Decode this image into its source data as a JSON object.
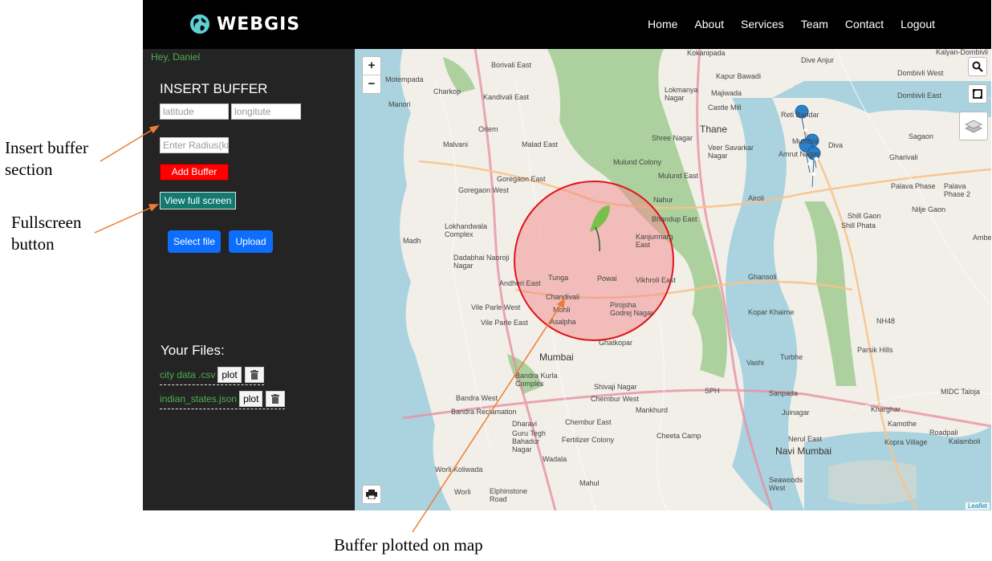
{
  "annotations": {
    "insert_buffer": [
      "Insert buffer",
      "section"
    ],
    "fullscreen": [
      "Fullscreen",
      "button"
    ],
    "buffer_map": "Buffer plotted on map"
  },
  "navbar": {
    "brand": "WEBGIS",
    "links": [
      "Home",
      "About",
      "Services",
      "Team",
      "Contact",
      "Logout"
    ]
  },
  "sidebar": {
    "greeting": "Hey, Daniel",
    "insert_title": "INSERT BUFFER",
    "latitude_placeholder": "latitude",
    "longitude_placeholder": "longitute",
    "radius_placeholder": "Enter Radius(km",
    "add_buffer_label": "Add Buffer",
    "fullscreen_label": "View full screen",
    "select_file_label": "Select file",
    "upload_label": "Upload",
    "files_title": "Your Files:",
    "files": [
      {
        "name": "city data .csv",
        "plot_label": "plot"
      },
      {
        "name": "indian_states.json",
        "plot_label": "plot"
      }
    ]
  },
  "map": {
    "zoom_in": "+",
    "zoom_out": "−",
    "attribution": "Leaflet",
    "labels": {
      "big_1": "Thane",
      "big_2": "Mumbai",
      "big_3": "Navi Mumbai",
      "l01": "Borivali East",
      "l02": "Kandivali East",
      "l03": "Charkop",
      "l04": "Malvani",
      "l05": "Malad East",
      "l06": "Orlem",
      "l07": "Goregaon East",
      "l08": "Goregaon West",
      "l09": "Lokhandwala Complex",
      "l10": "Dadabhai Naoroji Nagar",
      "l11": "Andheri East",
      "l12": "Vile Parle West",
      "l13": "Vile Parle East",
      "l14": "Madh",
      "l15": "Manori",
      "l16": "Motempada",
      "l17": "Kokanipada",
      "l18": "Lokmanya Nagar",
      "l19": "Majiwada",
      "l20": "Castle Mill",
      "l21": "Kapur Bawadi",
      "l22": "Dive Anjur",
      "l23": "Kalyan-Dombivli",
      "l24": "Dombivli West",
      "l25": "Dombivli East",
      "l26": "Reti Bandar",
      "l27": "Mumbra",
      "l28": "Diva",
      "l29": "Amrut Nagar",
      "l30": "Sagaon",
      "l31": "Gharivali",
      "l32": "Palava Phase",
      "l33": "Palava Phase 2",
      "l34": "Nilje Gaon",
      "l35": "Shill Phata",
      "l36": "Shill Gaon",
      "l37": "Shree Nagar",
      "l38": "Veer Savarkar Nagar",
      "l39": "Mulund Colony",
      "l40": "Mulund East",
      "l41": "Airoli",
      "l42": "Nahur",
      "l43": "Bhandup East",
      "l44": "Kanjurmarg East",
      "l45": "Vikhroli East",
      "l46": "Powai",
      "l47": "Tunga",
      "l48": "Chandivali",
      "l49": "Mohli",
      "l50": "Asalpha",
      "l51": "Pirojsha Godrej Nagar",
      "l52": "Ghatkopar",
      "l53": "Ghansoli",
      "l54": "Kopar Khairne",
      "l55": "Vashi",
      "l56": "Turbhe",
      "l57": "Sanpada",
      "l58": "Juinagar",
      "l59": "Nerul East",
      "l60": "Shivaji Nagar",
      "l61": "Chembur West",
      "l62": "Chembur East",
      "l63": "Mankhurd",
      "l64": "Cheeta Camp",
      "l65": "Bandra Kurla Complex",
      "l66": "Bandra West",
      "l67": "Bandra Reclamation",
      "l68": "Dharavi",
      "l69": "Guru Tegh Bahadur Nagar",
      "l70": "Fertilizer Colony",
      "l71": "Wadala",
      "l72": "Mahul",
      "l73": "Worli Koliwada",
      "l74": "Worli",
      "l75": "Elphinstone Road",
      "l76": "Seawoods West",
      "l77": "Kharghar",
      "l78": "Kamothe",
      "l79": "Kalamboli",
      "l80": "Roadpali",
      "l81": "Kopra Village",
      "l82": "MIDC Taloja",
      "l83": "Parsik Hills",
      "l84": "NH48",
      "l85": "SPH",
      "l86": "Ambernath"
    }
  },
  "colors": {
    "navbar": "#000000",
    "sidebar": "#242424",
    "add_buffer": "#ff0000",
    "fullscreen": "#127a73",
    "primary": "#0d6efd",
    "file_link": "#4caf50",
    "buffer_stroke": "#e0141b",
    "buffer_fill": "#f08a8a",
    "marker": "#2a81cb",
    "arrow": "#ed7d31"
  }
}
